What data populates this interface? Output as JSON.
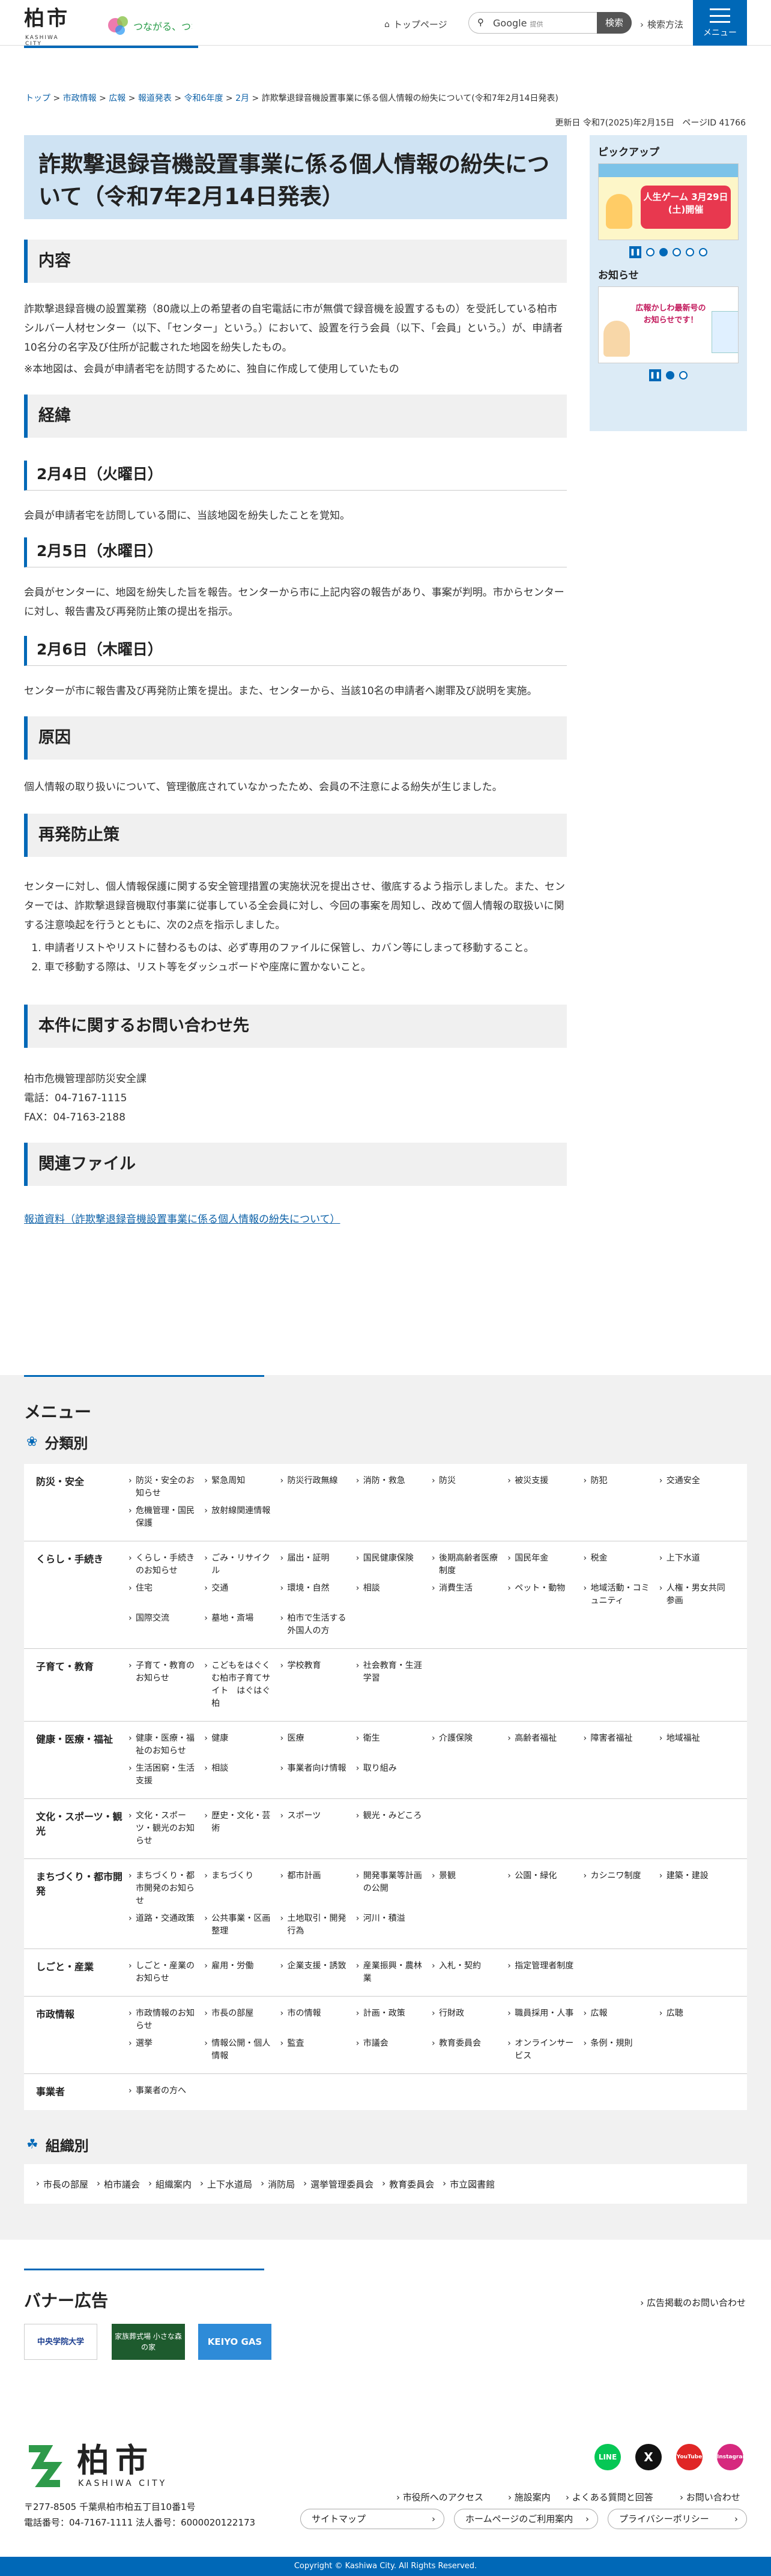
{
  "header": {
    "logo_kanji": "柏市",
    "logo_en": "KASHIWA CITY",
    "tagline": "つながる、つなぐ。",
    "top_link": "トップページ",
    "search_placeholder": "Google",
    "search_sub": "提供",
    "search_button": "検索",
    "search_howto": "検索方法",
    "menu_label": "メニュー"
  },
  "breadcrumb": [
    "トップ",
    "市政情報",
    "広報",
    "報道発表",
    "令和6年度",
    "2月",
    "詐欺撃退録音機設置事業に係る個人情報の紛失について(令和7年2月14日発表)"
  ],
  "meta": {
    "updated": "更新日 令和7(2025)年2月15日",
    "page_id": "ページID 41766"
  },
  "page_title": "詐欺撃退録音機設置事業に係る個人情報の紛失について（令和7年2月14日発表）",
  "sections": {
    "naiyo": {
      "heading": "内容",
      "p1": "詐欺撃退録音機の設置業務（80歳以上の希望者の自宅電話に市が無償で録音機を設置するもの）を受託している柏市シルバー人材センター（以下、「センター」という。）において、設置を行う会員（以下、「会員」という。）が、申請者10名分の名字及び住所が記載された地図を紛失したもの。",
      "p2": "※本地図は、会員が申請者宅を訪問するために、独自に作成して使用していたもの"
    },
    "keii": {
      "heading": "経緯",
      "d1": "2月4日（火曜日）",
      "d1_text": "会員が申請者宅を訪問している間に、当該地図を紛失したことを覚知。",
      "d2": "2月5日（水曜日）",
      "d2_text": "会員がセンターに、地図を紛失した旨を報告。センターから市に上記内容の報告があり、事案が判明。市からセンターに対し、報告書及び再発防止策の提出を指示。",
      "d3": "2月6日（木曜日）",
      "d3_text": "センターが市に報告書及び再発防止策を提出。また、センターから、当該10名の申請者へ謝罪及び説明を実施。"
    },
    "genin": {
      "heading": "原因",
      "text": "個人情報の取り扱いについて、管理徹底されていなかったため、会員の不注意による紛失が生じました。"
    },
    "boushi": {
      "heading": "再発防止策",
      "text": "センターに対し、個人情報保護に関する安全管理措置の実施状況を提出させ、徹底するよう指示しました。また、センターでは、詐欺撃退録音機取付事業に従事している全会員に対し、今回の事案を周知し、改めて個人情報の取扱いに関する注意喚起を行うとともに、次の2点を指示しました。",
      "items": [
        "申請者リストやリストに替わるものは、必ず専用のファイルに保管し、カバン等にしまって移動すること。",
        "車で移動する際は、リスト等をダッシュボードや座席に置かないこと。"
      ]
    },
    "contact": {
      "heading": "本件に関するお問い合わせ先",
      "org": "柏市危機管理部防災安全課",
      "tel": "電話：04-7167-1115",
      "fax": "FAX：04-7163-2188"
    },
    "files": {
      "heading": "関連ファイル",
      "link": "報道資料（詐欺撃退録音機設置事業に係る個人情報の紛失について）"
    }
  },
  "side": {
    "pickup": "ピックアップ",
    "pickup_card": "人生ゲーム 3月29日(土)開催",
    "oshirase": "お知らせ",
    "oshirase_card": "広報かしわ最新号のお知らせです！"
  },
  "menu": {
    "title": "メニュー",
    "bunrui": "分類別",
    "categories": [
      {
        "name": "防災・安全",
        "items": [
          "防災・安全のお知らせ",
          "緊急周知",
          "防災行政無線",
          "消防・救急",
          "防災",
          "被災支援",
          "防犯",
          "交通安全",
          "危機管理・国民保護",
          "放射線関連情報"
        ]
      },
      {
        "name": "くらし・手続き",
        "items": [
          "くらし・手続きのお知らせ",
          "ごみ・リサイクル",
          "届出・証明",
          "国民健康保険",
          "後期高齢者医療制度",
          "国民年金",
          "税金",
          "上下水道",
          "住宅",
          "交通",
          "環境・自然",
          "相談",
          "消費生活",
          "ペット・動物",
          "地域活動・コミュニティ",
          "人権・男女共同参画",
          "国際交流",
          "墓地・斎場",
          "柏市で生活する外国人の方"
        ]
      },
      {
        "name": "子育て・教育",
        "items": [
          "子育て・教育のお知らせ",
          "こどもをはぐくむ柏市子育てサイト　はぐはぐ柏",
          "学校教育",
          "社会教育・生涯学習"
        ]
      },
      {
        "name": "健康・医療・福祉",
        "items": [
          "健康・医療・福祉のお知らせ",
          "健康",
          "医療",
          "衛生",
          "介護保険",
          "高齢者福祉",
          "障害者福祉",
          "地域福祉",
          "生活困窮・生活支援",
          "相談",
          "事業者向け情報",
          "取り組み"
        ]
      },
      {
        "name": "文化・スポーツ・観光",
        "items": [
          "文化・スポーツ・観光のお知らせ",
          "歴史・文化・芸術",
          "スポーツ",
          "観光・みどころ"
        ]
      },
      {
        "name": "まちづくり・都市開発",
        "items": [
          "まちづくり・都市開発のお知らせ",
          "まちづくり",
          "都市計画",
          "開発事業等計画の公開",
          "景観",
          "公園・緑化",
          "カシニワ制度",
          "建築・建設",
          "道路・交通政策",
          "公共事業・区画整理",
          "土地取引・開発行為",
          "河川・積溢"
        ]
      },
      {
        "name": "しごと・産業",
        "items": [
          "しごと・産業のお知らせ",
          "雇用・労働",
          "企業支援・誘致",
          "産業振興・農林業",
          "入札・契約",
          "指定管理者制度"
        ]
      },
      {
        "name": "市政情報",
        "items": [
          "市政情報のお知らせ",
          "市長の部屋",
          "市の情報",
          "計画・政策",
          "行財政",
          "職員採用・人事",
          "広報",
          "広聴",
          "選挙",
          "情報公開・個人情報",
          "監査",
          "市議会",
          "教育委員会",
          "オンラインサービス",
          "条例・規則"
        ]
      },
      {
        "name": "事業者",
        "items": [
          "事業者の方へ"
        ]
      }
    ],
    "soshiki": "組織別",
    "orgs": [
      "市長の部屋",
      "柏市議会",
      "組織案内",
      "上下水道局",
      "消防局",
      "選挙管理委員会",
      "教育委員会",
      "市立図書館"
    ]
  },
  "banner": {
    "title": "バナー広告",
    "info_link": "広告掲載のお問い合わせ",
    "ads": [
      "中央学院大学",
      "家族葬式場 小さな森の家",
      "KEIYO GAS"
    ]
  },
  "footer": {
    "logo_kanji": "柏市",
    "logo_en": "KASHIWA CITY",
    "address": "〒277-8505 千葉県柏市柏五丁目10番1号",
    "phone": "電話番号：04-7167-1111  法人番号：6000020122173",
    "links": [
      "市役所へのアクセス",
      "施設案内",
      "よくある質問と回答",
      "お問い合わせ"
    ],
    "pills": [
      "サイトマップ",
      "ホームページのご利用案内",
      "プライバシーポリシー"
    ],
    "sns": [
      "LINE",
      "X",
      "YouTube",
      "Instagram"
    ],
    "copyright": "Copyright © Kashiwa City. All Rights Reserved."
  }
}
